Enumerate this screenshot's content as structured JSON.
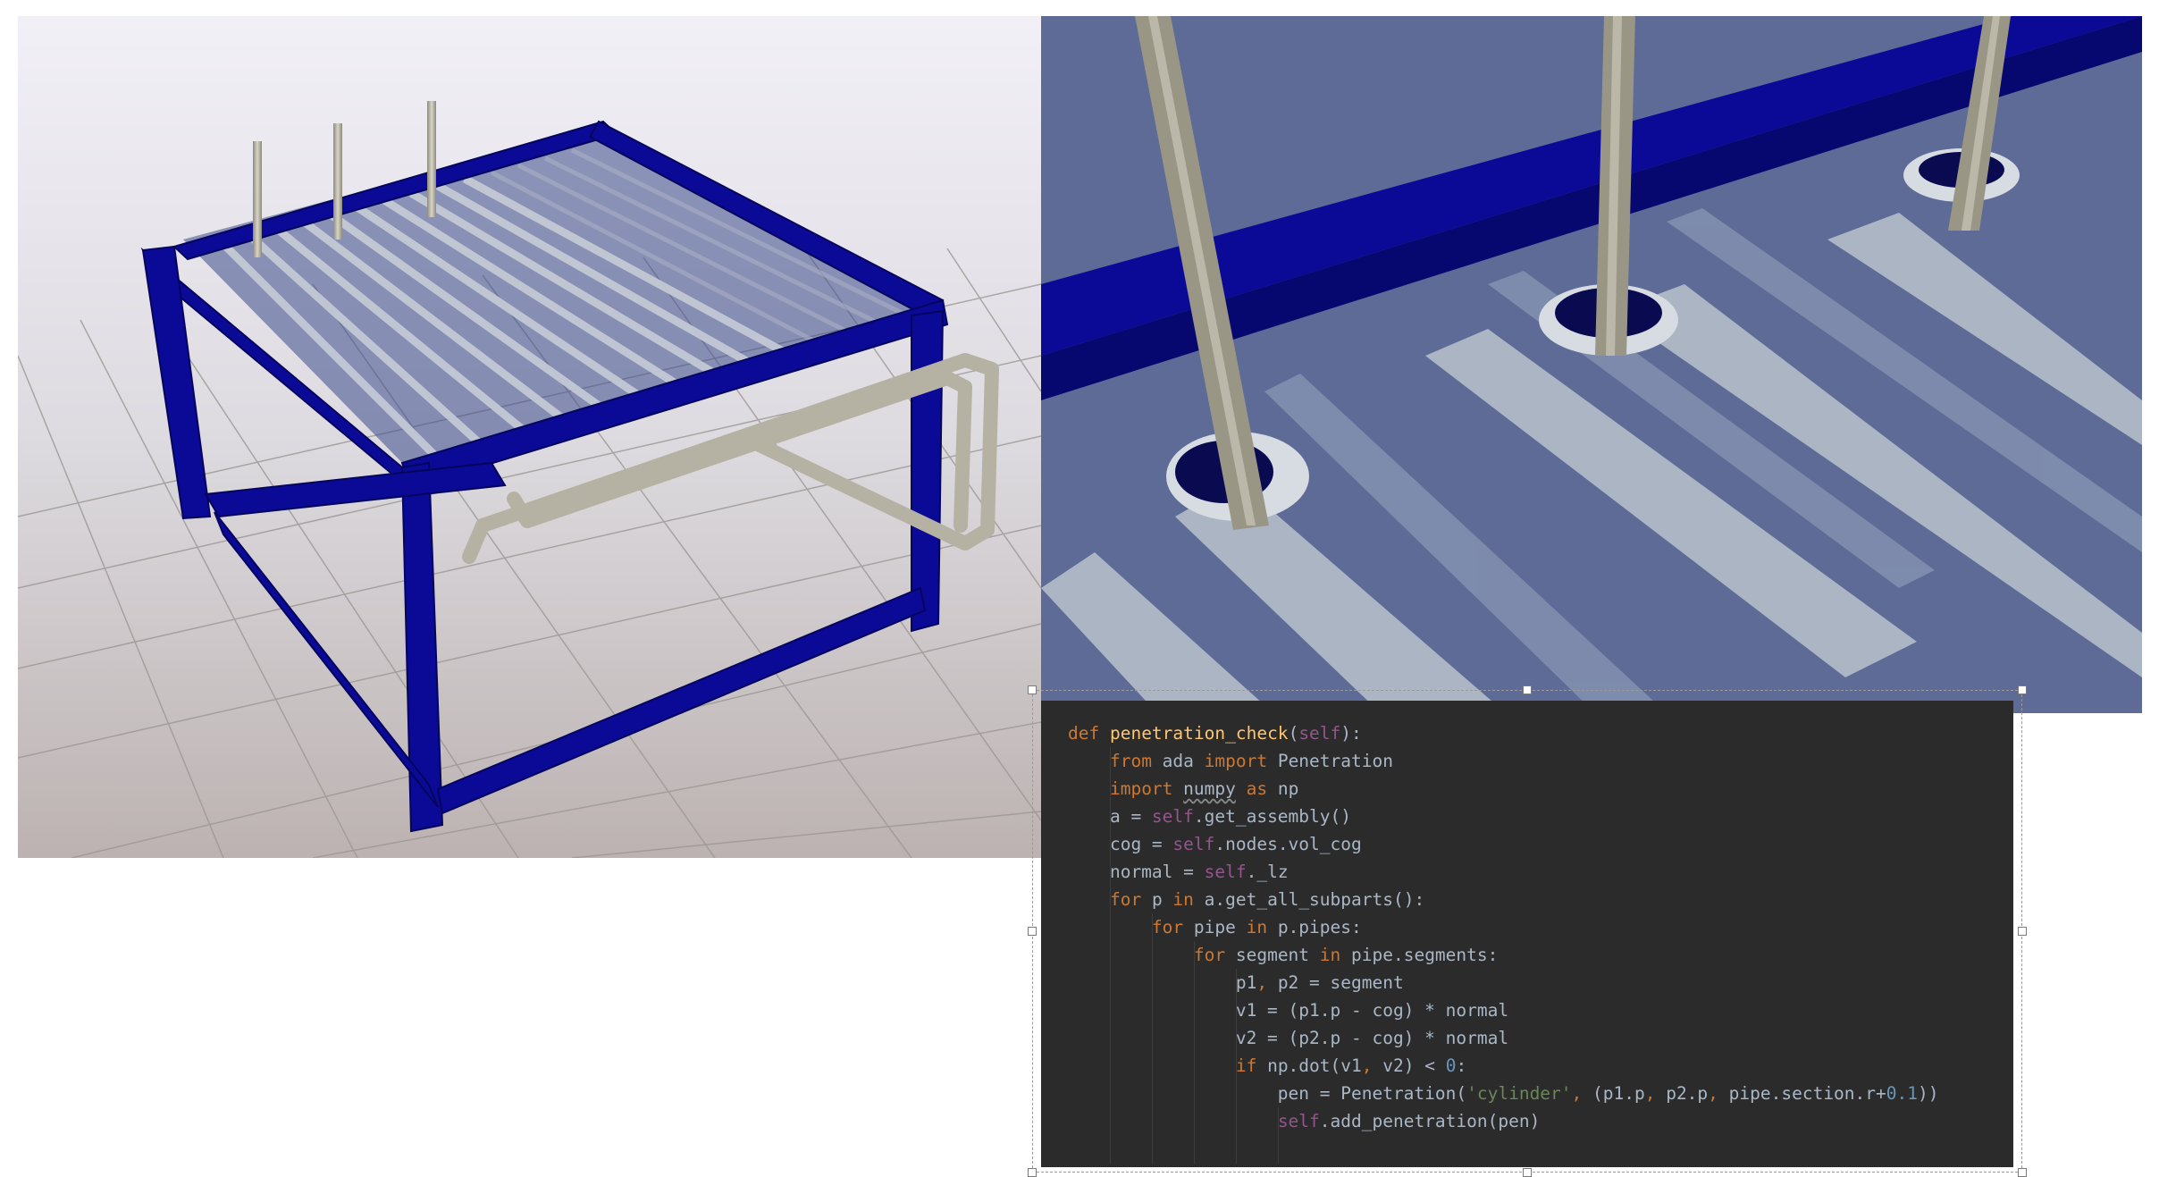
{
  "code": {
    "lines": [
      [
        {
          "t": "def ",
          "c": "kw"
        },
        {
          "t": "penetration_check",
          "c": "fn"
        },
        {
          "t": "("
        },
        {
          "t": "self",
          "c": "slf"
        },
        {
          "t": "):"
        }
      ],
      [
        {
          "t": "    "
        },
        {
          "t": "from ",
          "c": "kw"
        },
        {
          "t": "ada "
        },
        {
          "t": "import ",
          "c": "kw"
        },
        {
          "t": "Penetration"
        }
      ],
      [
        {
          "t": "    "
        },
        {
          "t": "import ",
          "c": "kw"
        },
        {
          "t": "numpy",
          "c": "wavy"
        },
        {
          "t": " "
        },
        {
          "t": "as ",
          "c": "kw"
        },
        {
          "t": "np"
        }
      ],
      [
        {
          "t": "    a = "
        },
        {
          "t": "self",
          "c": "slf"
        },
        {
          "t": ".get_assembly()"
        }
      ],
      [
        {
          "t": "    cog = "
        },
        {
          "t": "self",
          "c": "slf"
        },
        {
          "t": ".nodes.vol_cog"
        }
      ],
      [
        {
          "t": "    normal = "
        },
        {
          "t": "self",
          "c": "slf"
        },
        {
          "t": "._lz"
        }
      ],
      [
        {
          "t": "    "
        },
        {
          "t": "for ",
          "c": "kw"
        },
        {
          "t": "p "
        },
        {
          "t": "in ",
          "c": "kw"
        },
        {
          "t": "a.get_all_subparts():"
        }
      ],
      [
        {
          "t": "        "
        },
        {
          "t": "for ",
          "c": "kw"
        },
        {
          "t": "pipe "
        },
        {
          "t": "in ",
          "c": "kw"
        },
        {
          "t": "p.pipes:"
        }
      ],
      [
        {
          "t": "            "
        },
        {
          "t": "for ",
          "c": "kw"
        },
        {
          "t": "segment "
        },
        {
          "t": "in ",
          "c": "kw"
        },
        {
          "t": "pipe.segments:"
        }
      ],
      [
        {
          "t": "                p1"
        },
        {
          "t": ", ",
          "c": "kw"
        },
        {
          "t": "p2 = segment"
        }
      ],
      [
        {
          "t": "                v1 = (p1.p - cog) * normal"
        }
      ],
      [
        {
          "t": "                v2 = (p2.p - cog) * normal"
        }
      ],
      [
        {
          "t": "                "
        },
        {
          "t": "if ",
          "c": "kw"
        },
        {
          "t": "np.dot(v1"
        },
        {
          "t": ", ",
          "c": "kw"
        },
        {
          "t": "v2) < "
        },
        {
          "t": "0",
          "c": "num"
        },
        {
          "t": ":"
        }
      ],
      [
        {
          "t": "                    pen = Penetration("
        },
        {
          "t": "'cylinder'",
          "c": "str"
        },
        {
          "t": ", ",
          "c": "kw"
        },
        {
          "t": "(p1.p"
        },
        {
          "t": ", ",
          "c": "kw"
        },
        {
          "t": "p2.p"
        },
        {
          "t": ", ",
          "c": "kw"
        },
        {
          "t": "pipe.section.r+"
        },
        {
          "t": "0.1",
          "c": "num"
        },
        {
          "t": "))"
        }
      ],
      [
        {
          "t": "                    "
        },
        {
          "t": "self",
          "c": "slf"
        },
        {
          "t": ".add_penetration(pen)"
        }
      ]
    ]
  },
  "colors": {
    "frame_blue": "#0a0a96",
    "pipe_grey": "#b5b1a3",
    "code_bg": "#2b2b2b"
  }
}
